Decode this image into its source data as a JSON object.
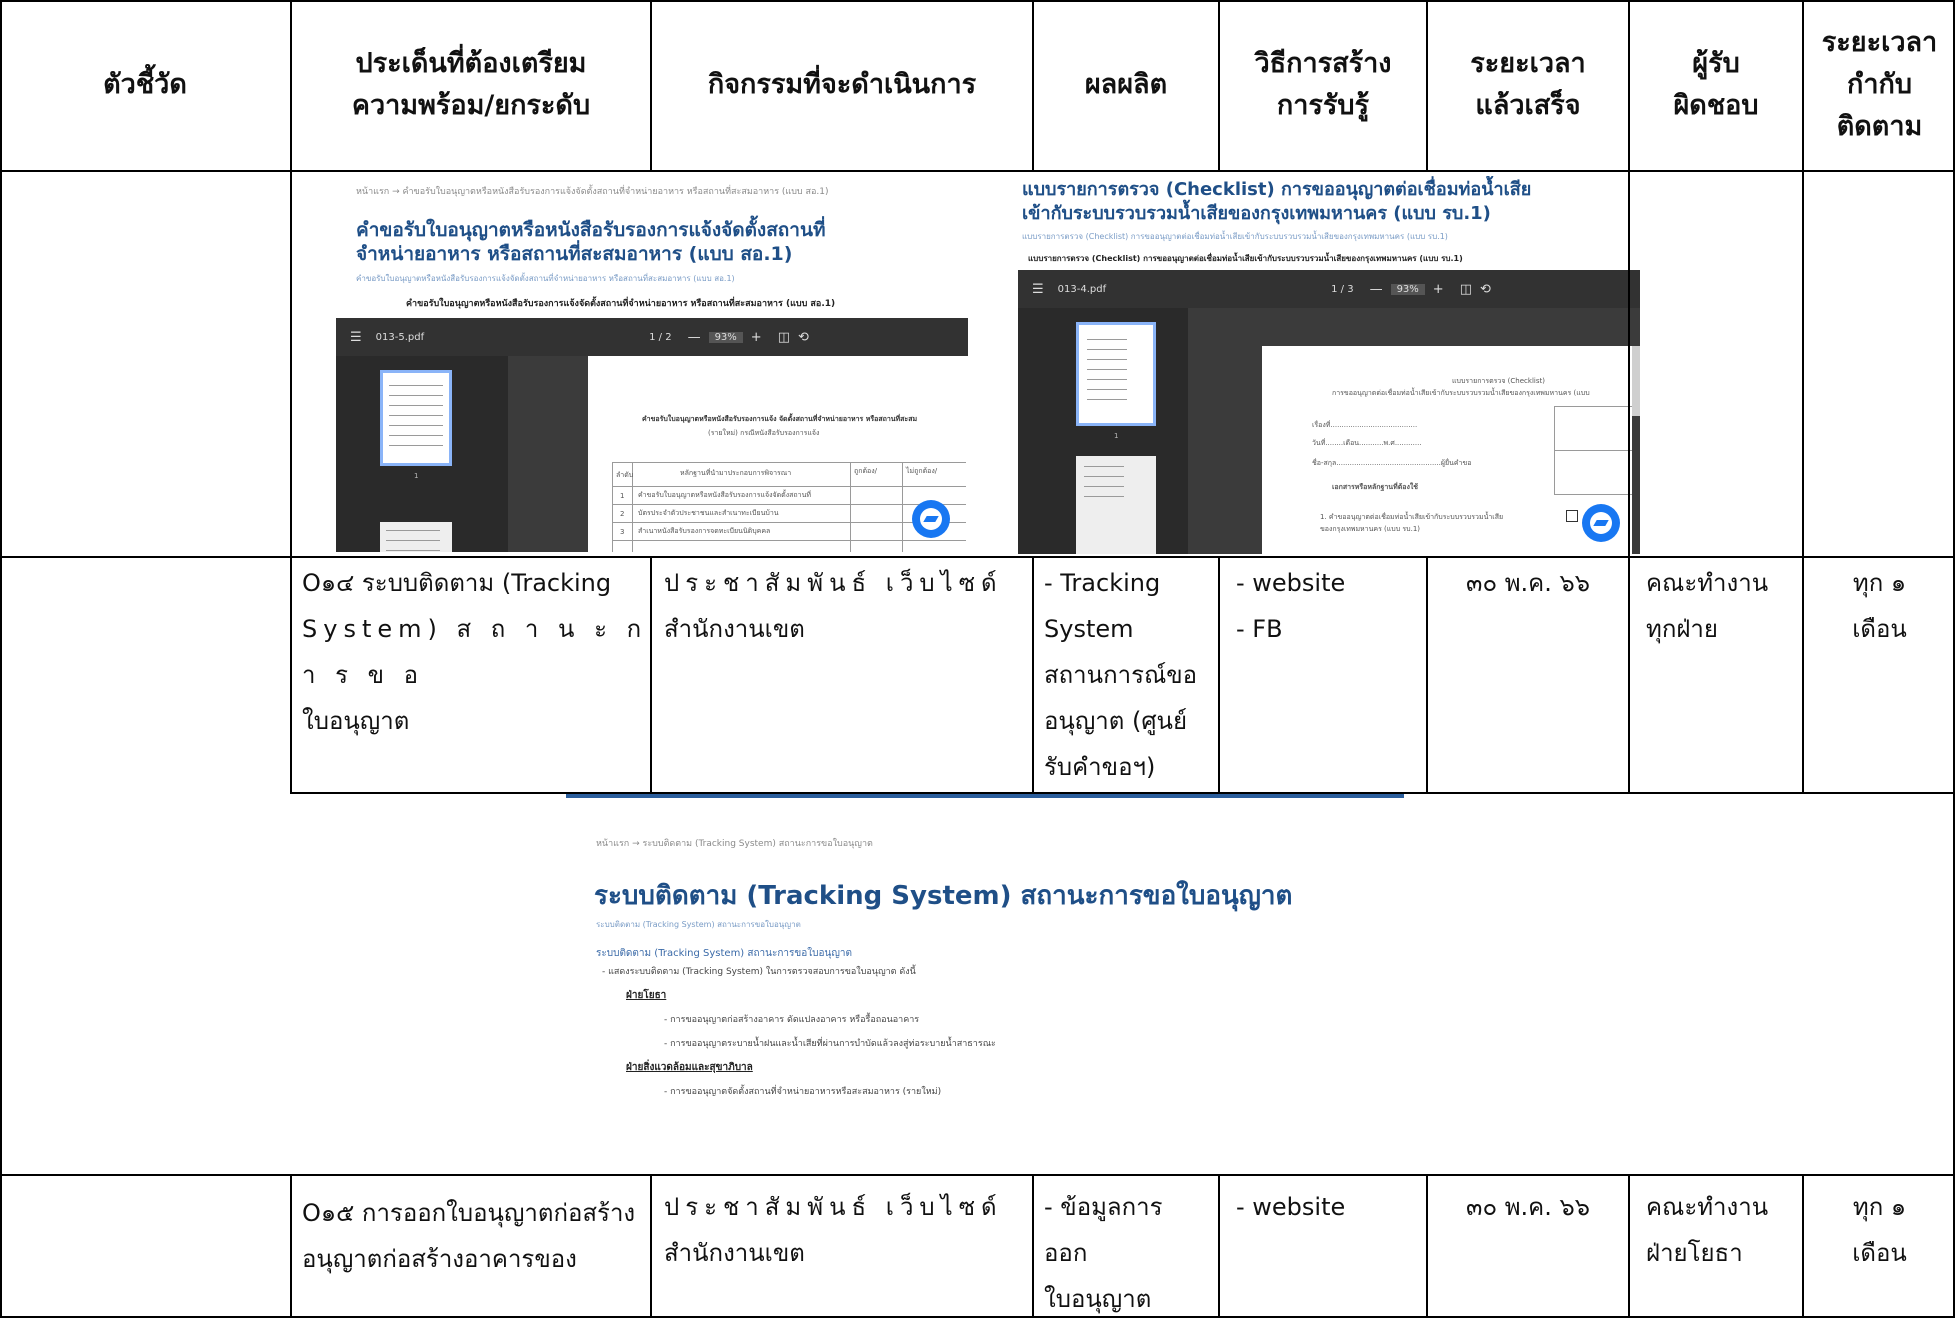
{
  "header": {
    "col1": "ตัวชี้วัด",
    "col2": "ประเด็นที่ต้องเตรียม\nความพร้อม/ยกระดับ",
    "col3": "กิจกรรมที่จะดำเนินการ",
    "col4": "ผลผลิต",
    "col5": "วิธีการสร้าง\nการรับรู้",
    "col6": "ระยะเวลา\nแล้วเสร็จ",
    "col7": "ผู้รับ\nผิดชอบ",
    "col8": "ระยะเวลา\nกำกับ\nติดตาม"
  },
  "shot_left": {
    "breadcrumb": "หน้าแรก → คำขอรับใบอนุญาตหรือหนังสือรับรองการแจ้งจัดตั้งสถานที่จำหน่ายอาหาร หรือสถานที่สะสมอาหาร (แบบ สอ.1)",
    "title_line1": "คำขอรับใบอนุญาตหรือหนังสือรับรองการแจ้งจัดตั้งสถานที่",
    "title_line2": "จำหน่ายอาหาร หรือสถานที่สะสมอาหาร (แบบ สอ.1)",
    "subtitle": "คำขอรับใบอนุญาตหรือหนังสือรับรองการแจ้งจัดตั้งสถานที่จำหน่ายอาหาร หรือสถานที่สะสมอาหาร (แบบ สอ.1)",
    "doc_heading": "คำขอรับใบอนุญาตหรือหนังสือรับรองการแจ้งจัดตั้งสถานที่จำหน่ายอาหาร หรือสถานที่สะสมอาหาร (แบบ สอ.1)",
    "file_name": "013-5.pdf",
    "page_indicator": "1 / 2",
    "zoom": "93%"
  },
  "shot_right": {
    "title_line1": "แบบรายการตรวจ (Checklist) การขออนุญาตต่อเชื่อมท่อน้ำเสีย",
    "title_line2": "เข้ากับระบบรวบรวมน้ำเสียของกรุงเทพมหานคร (แบบ รบ.1)",
    "subtitle": "แบบรายการตรวจ (Checklist) การขออนุญาตต่อเชื่อมท่อน้ำเสียเข้ากับระบบรวบรวมน้ำเสียของกรุงเทพมหานคร (แบบ รบ.1)",
    "doc_heading": "แบบรายการตรวจ (Checklist) การขออนุญาตต่อเชื่อมท่อน้ำเสียเข้ากับระบบรวบรวมน้ำเสียของกรุงเทพมหานคร (แบบ รบ.1)",
    "file_name": "013-4.pdf",
    "page_indicator": "1 / 3",
    "zoom": "93%"
  },
  "row1": {
    "col2": "O๑๔ ระบบติดตาม (Tracking System) สถานะการขอใบอนุญาต",
    "col2_a": "O๑๔ ระบบติดตาม (Tracking",
    "col2_b": "System) ส ถ า น ะ ก า ร ข อ",
    "col2_c": "ใบอนุญาต",
    "col3_a": "ประชาสัมพันธ์ เว็บไซด์",
    "col3_b": "สำนักงานเขต",
    "col4": "- Tracking\nSystem\nสถานการณ์ขอ\nอนุญาต (ศูนย์\nรับคำขอฯ)",
    "col5": "- website\n- FB",
    "col6": "๓๐ พ.ค. ๖๖",
    "col7": "คณะทำงาน\nทุกฝ่าย",
    "col8": "ทุก ๑\nเดือน"
  },
  "shot_tracking": {
    "breadcrumb": "หน้าแรก → ระบบติดตาม (Tracking System) สถานะการขอใบอนุญาต",
    "title": "ระบบติดตาม (Tracking System) สถานะการขอใบอนุญาต",
    "subtitle": "ระบบติดตาม (Tracking System) สถานะการขอใบอนุญาต",
    "section": "ระบบติดตาม (Tracking System) สถานะการขอใบอนุญาต",
    "intro": "- แสดงระบบติดตาม (Tracking System) ในการตรวจสอบการขอใบอนุญาต ดังนี้",
    "head1": "ฝ่ายโยธา",
    "item1": "- การขออนุญาตก่อสร้างอาคาร ดัดแปลงอาคาร หรือรื้อถอนอาคาร",
    "item2": "- การขออนุญาตระบายน้ำฝนและน้ำเสียที่ผ่านการบำบัดแล้วลงสู่ท่อระบายน้ำสาธารณะ",
    "head2": "ฝ่ายสิ่งแวดล้อมและสุขาภิบาล",
    "item3": "- การขออนุญาตจัดตั้งสถานที่จำหน่ายอาหารหรือสะสมอาหาร (รายใหม่)"
  },
  "row2": {
    "col2_a": "O๑๕ การออกใบอนุญาตก่อสร้าง",
    "col2_b": "อนุญาตก่อสร้างอาคารของ",
    "col3_a": "ประชาสัมพันธ์ เว็บไซด์",
    "col3_b": "สำนักงานเขต",
    "col4": "- ข้อมูลการ\nออก\nใบอนุญาต",
    "col5": "- website",
    "col6": "๓๐ พ.ค. ๖๖",
    "col7": "คณะทำงาน\nฝ่ายโยธา",
    "col8": "ทุก ๑\nเดือน"
  },
  "colors": {
    "title_blue": "#1f4f87",
    "viewer_dark": "#323232",
    "messenger": "#1877f2"
  }
}
